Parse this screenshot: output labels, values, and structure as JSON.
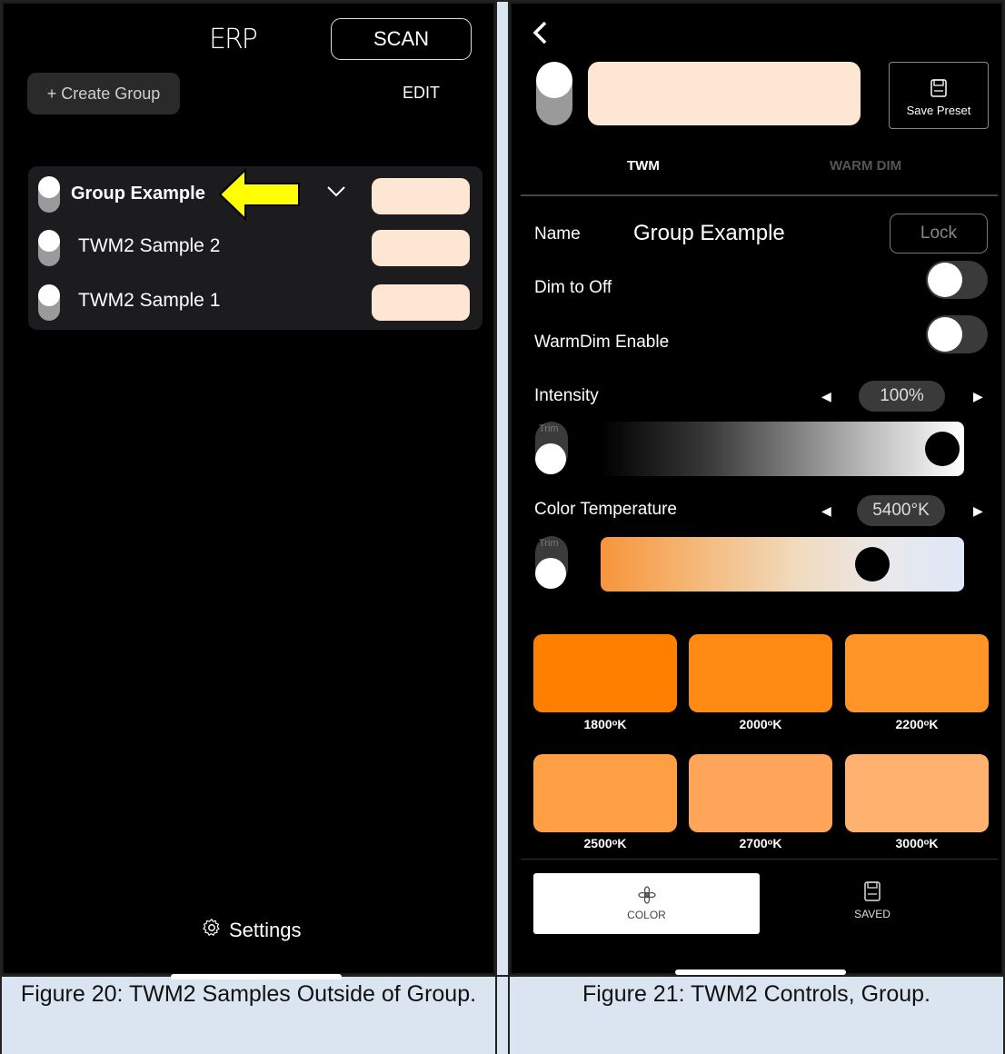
{
  "left": {
    "logo": "ERP",
    "scan_label": "SCAN",
    "create_group_label": "+ Create Group",
    "edit_label": "EDIT",
    "group": {
      "name": "Group Example",
      "items": [
        {
          "label": "TWM2 Sample 2"
        },
        {
          "label": "TWM2 Sample 1"
        }
      ]
    },
    "settings_label": "Settings",
    "caption": "Figure 20: TWM2 Samples Outside of Group."
  },
  "right": {
    "save_preset_label": "Save Preset",
    "tabs": [
      "TWM",
      "WARM DIM"
    ],
    "name_label": "Name",
    "name_value": "Group Example",
    "lock_label": "Lock",
    "dim_to_off_label": "Dim to Off",
    "warmdim_enable_label": "WarmDim Enable",
    "intensity_label": "Intensity",
    "intensity_value": "100%",
    "trim_label": "Trim",
    "color_temp_label": "Color Temperature",
    "color_temp_value": "5400°K",
    "intensity_level": 1.0,
    "color_temp_level": 0.78,
    "presets": [
      {
        "label": "1800ᵒK",
        "color": "#ff7f00"
      },
      {
        "label": "2000ᵒK",
        "color": "#ff8a14"
      },
      {
        "label": "2200ᵒK",
        "color": "#ff9528"
      },
      {
        "label": "2500ᵒK",
        "color": "#ff9f44"
      },
      {
        "label": "2700ᵒK",
        "color": "#ffa559"
      },
      {
        "label": "3000ᵒK",
        "color": "#ffb16f"
      }
    ],
    "nav": {
      "color_label": "COLOR",
      "saved_label": "SAVED"
    },
    "caption": "Figure 21: TWM2 Controls, Group."
  },
  "colors": {
    "swatch": "#fde6d3",
    "caption_bg": "#dbe5f1",
    "highlight_arrow": "#ffff00"
  }
}
